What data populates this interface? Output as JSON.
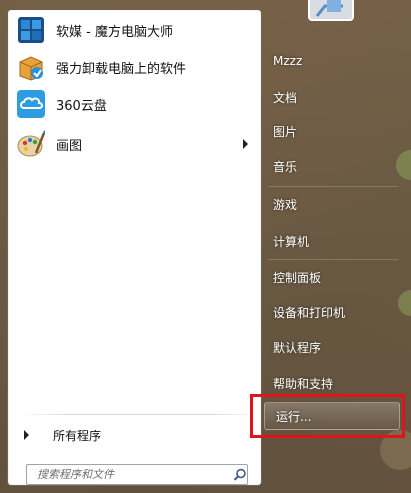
{
  "start_menu": {
    "programs": [
      {
        "label": "软媒 - 魔方电脑大师",
        "icon": "cube-app-icon",
        "has_submenu": false
      },
      {
        "label": "强力卸载电脑上的软件",
        "icon": "uninstall-box-icon",
        "has_submenu": false
      },
      {
        "label": "360云盘",
        "icon": "cloud-drive-icon",
        "has_submenu": false
      },
      {
        "label": "画图",
        "icon": "paint-palette-icon",
        "has_submenu": true
      }
    ],
    "all_programs_label": "所有程序",
    "search": {
      "placeholder": "搜索程序和文件",
      "value": ""
    },
    "right_links": [
      {
        "label": "Mzzz"
      },
      {
        "label": "文档"
      },
      {
        "label": "图片"
      },
      {
        "label": "音乐"
      },
      {
        "label": "游戏"
      },
      {
        "label": "计算机"
      },
      {
        "label": "控制面板"
      },
      {
        "label": "设备和打印机"
      },
      {
        "label": "默认程序"
      },
      {
        "label": "帮助和支持"
      },
      {
        "label": "运行..."
      }
    ],
    "highlight_color": "#e0141a"
  }
}
